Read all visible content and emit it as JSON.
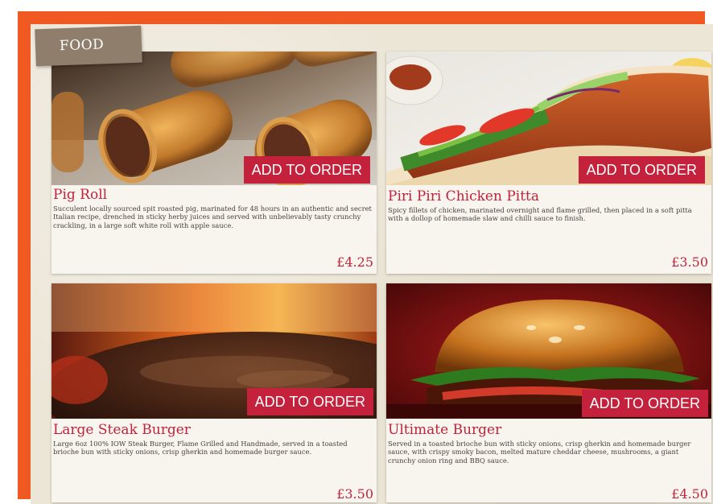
{
  "section": {
    "tab_label": "FOOD"
  },
  "items": [
    {
      "name": "Pig Roll",
      "description": "Succulent locally sourced spit roasted pig, marinated for 48 hours in an authentic and secret Italian recipe, drenched in sticky herby juices and served with unbelievably tasty crunchy crackling, in a large soft white roll with apple sauce.",
      "price": "£4.25",
      "button": "ADD TO ORDER"
    },
    {
      "name": "Piri Piri Chicken Pitta",
      "description": "Spicy fillets of chicken, marinated overnight and flame grilled, then placed in a soft pitta with a dollop of homemade slaw and chilli sauce to finish.",
      "price": "£3.50",
      "button": "ADD TO ORDER"
    },
    {
      "name": "Large Steak Burger",
      "description": "Large 6oz 100% IOW Steak Burger, Flame Grilled and Handmade, served in a toasted brioche bun with sticky onions, crisp gherkin and homemade burger sauce.",
      "price": "£3.50",
      "button": "ADD TO ORDER"
    },
    {
      "name": "Ultimate Burger",
      "description": "Served in a toasted brioche bun with sticky onions, crisp gherkin and homemade burger sauce, with crispy smoky bacon, melted mature cheddar cheese, mushrooms, a giant crunchy onion ring and BBQ sauce.",
      "price": "£4.50",
      "button": "ADD TO ORDER"
    }
  ]
}
